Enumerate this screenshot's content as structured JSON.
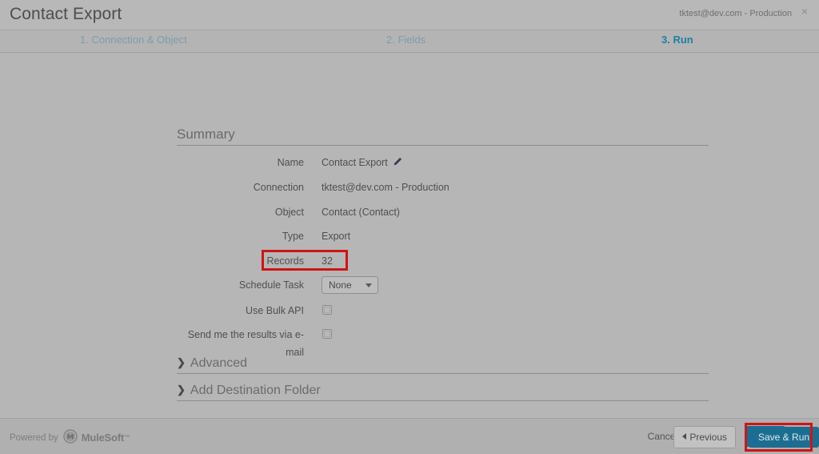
{
  "window": {
    "title": "Contact Export",
    "account": "tktest@dev.com - Production",
    "close_icon": "close-icon",
    "close_glyph": "×"
  },
  "steps": [
    {
      "label": "1. Connection & Object",
      "active": false
    },
    {
      "label": "2. Fields",
      "active": false
    },
    {
      "label": "3. Run",
      "active": true
    }
  ],
  "summary": {
    "heading": "Summary",
    "rows": [
      {
        "label": "Name",
        "value": "Contact Export",
        "edit_icon": "pencil-icon"
      },
      {
        "label": "Connection",
        "value": "tktest@dev.com - Production"
      },
      {
        "label": "Object",
        "value": "Contact (Contact)"
      },
      {
        "label": "Type",
        "value": "Export"
      },
      {
        "label": "Records",
        "value": "32",
        "highlighted": true
      },
      {
        "label": "Schedule Task",
        "value": "None",
        "control": "select"
      },
      {
        "label": "Use Bulk API",
        "value": "",
        "control": "checkbox",
        "checked": false
      },
      {
        "label": "Send me the results via e-mail",
        "value": "",
        "control": "checkbox",
        "checked": false
      }
    ]
  },
  "sections": [
    {
      "label": "Advanced",
      "chevron": "chevron-right-icon",
      "chevron_glyph": "❯",
      "expanded": false
    },
    {
      "label": "Add Destination Folder",
      "chevron": "chevron-right-icon",
      "chevron_glyph": "❯",
      "expanded": false
    }
  ],
  "footer": {
    "powered_by": "Powered by",
    "brand": "MuleSoft",
    "trademark": "™",
    "logo_icon": "mulesoft-logo-icon",
    "cancel_label": "Cancel",
    "previous_label": "Previous",
    "save_label": "Save",
    "save_run_label": "Save & Run"
  },
  "annotations": {
    "highlight_color": "#d01414",
    "targets": [
      "records-row",
      "save-run-button"
    ]
  },
  "colors": {
    "accent_button": "#1b6e91",
    "step_active": "#1f7fa3",
    "step_inactive": "#7f9bab",
    "background": "#b6b6b6"
  }
}
